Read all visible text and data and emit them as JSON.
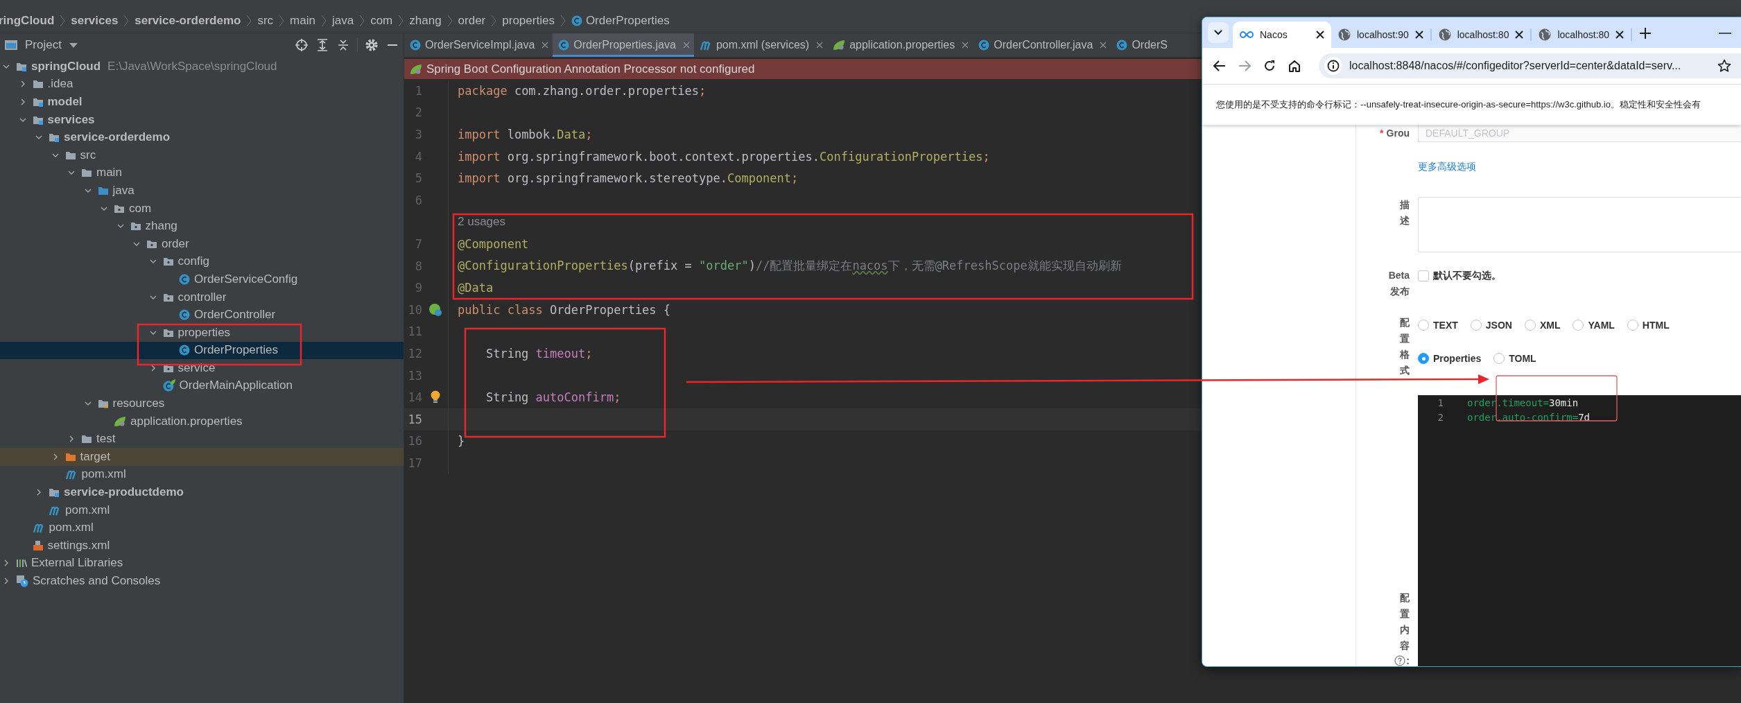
{
  "ide": {
    "breadcrumbs": [
      {
        "label": "ringCloud",
        "kind": "module"
      },
      {
        "label": "services",
        "kind": "module"
      },
      {
        "label": "service-orderdemo",
        "kind": "module"
      },
      {
        "label": "src",
        "kind": "folder"
      },
      {
        "label": "main",
        "kind": "folder"
      },
      {
        "label": "java",
        "kind": "folder"
      },
      {
        "label": "com",
        "kind": "folder"
      },
      {
        "label": "zhang",
        "kind": "folder"
      },
      {
        "label": "order",
        "kind": "folder"
      },
      {
        "label": "properties",
        "kind": "folder"
      },
      {
        "label": "OrderProperties",
        "kind": "class"
      }
    ],
    "project_panel": {
      "title": "Project",
      "tree": [
        {
          "label": "springCloud",
          "kind": "module",
          "path": "E:\\Java\\WorkSpace\\springCloud",
          "expanded": true,
          "selected": false,
          "children": [
            {
              "label": ".idea",
              "kind": "folder",
              "expanded": false,
              "selected": false
            },
            {
              "label": "model",
              "kind": "module",
              "expanded": false,
              "selected": false
            },
            {
              "label": "services",
              "kind": "module",
              "expanded": true,
              "selected": false,
              "children": [
                {
                  "label": "service-orderdemo",
                  "kind": "module",
                  "expanded": true,
                  "selected": false,
                  "children": [
                    {
                      "label": "src",
                      "kind": "folder",
                      "expanded": true,
                      "selected": false,
                      "children": [
                        {
                          "label": "main",
                          "kind": "folder",
                          "expanded": true,
                          "selected": false,
                          "children": [
                            {
                              "label": "java",
                              "kind": "source-folder",
                              "expanded": true,
                              "selected": false,
                              "children": [
                                {
                                  "label": "com",
                                  "kind": "package",
                                  "expanded": true,
                                  "selected": false,
                                  "children": [
                                    {
                                      "label": "zhang",
                                      "kind": "package",
                                      "expanded": true,
                                      "selected": false,
                                      "children": [
                                        {
                                          "label": "order",
                                          "kind": "package",
                                          "expanded": true,
                                          "selected": false,
                                          "children": [
                                            {
                                              "label": "config",
                                              "kind": "package",
                                              "expanded": true,
                                              "selected": false,
                                              "children": [
                                                {
                                                  "label": "OrderServiceConfig",
                                                  "kind": "class",
                                                  "selected": false
                                                }
                                              ]
                                            },
                                            {
                                              "label": "controller",
                                              "kind": "package",
                                              "expanded": true,
                                              "selected": false,
                                              "children": [
                                                {
                                                  "label": "OrderController",
                                                  "kind": "class",
                                                  "selected": false
                                                }
                                              ]
                                            },
                                            {
                                              "label": "properties",
                                              "kind": "package",
                                              "expanded": true,
                                              "selected": false,
                                              "children": [
                                                {
                                                  "label": "OrderProperties",
                                                  "kind": "class",
                                                  "selected": true
                                                }
                                              ]
                                            },
                                            {
                                              "label": "service",
                                              "kind": "package",
                                              "expanded": false,
                                              "selected": false
                                            },
                                            {
                                              "label": "OrderMainApplication",
                                              "kind": "spring-app",
                                              "selected": false
                                            }
                                          ]
                                        }
                                      ]
                                    }
                                  ]
                                }
                              ]
                            },
                            {
                              "label": "resources",
                              "kind": "resources",
                              "expanded": true,
                              "selected": false,
                              "children": [
                                {
                                  "label": "application.properties",
                                  "kind": "spring-properties",
                                  "selected": false
                                }
                              ]
                            }
                          ]
                        },
                        {
                          "label": "test",
                          "kind": "folder",
                          "expanded": false,
                          "selected": false
                        }
                      ]
                    },
                    {
                      "label": "target",
                      "kind": "excluded",
                      "expanded": false,
                      "selected": false
                    },
                    {
                      "label": "pom.xml",
                      "kind": "maven",
                      "selected": false
                    }
                  ]
                },
                {
                  "label": "service-productdemo",
                  "kind": "module",
                  "expanded": false,
                  "selected": false
                },
                {
                  "label": "pom.xml",
                  "kind": "maven",
                  "selected": false
                }
              ]
            },
            {
              "label": "pom.xml",
              "kind": "maven",
              "selected": false
            },
            {
              "label": "settings.xml",
              "kind": "xml",
              "selected": false
            }
          ]
        },
        {
          "label": "External Libraries",
          "kind": "libraries",
          "expanded": false,
          "selected": false
        },
        {
          "label": "Scratches and Consoles",
          "kind": "scratches",
          "expanded": false,
          "selected": false
        }
      ]
    },
    "editor": {
      "tabs": [
        {
          "title": "OrderServiceImpl.java",
          "kind": "class",
          "selected": false,
          "closable": true
        },
        {
          "title": "OrderProperties.java",
          "kind": "class",
          "selected": true,
          "closable": true
        },
        {
          "title": "pom.xml (services)",
          "kind": "maven",
          "selected": false,
          "closable": true
        },
        {
          "title": "application.properties",
          "kind": "spring-properties",
          "selected": false,
          "closable": true
        },
        {
          "title": "OrderController.java",
          "kind": "class",
          "selected": false,
          "closable": true
        },
        {
          "title": "OrderS",
          "kind": "class",
          "selected": false,
          "closable": false
        }
      ],
      "banner": "Spring Boot Configuration Annotation Processor not configured",
      "lines": [
        {
          "kind": "code",
          "number": "1",
          "current": false,
          "tokens": [
            {
              "kind": "kw",
              "text": "package"
            },
            {
              "kind": "plain",
              "text": " com.zhang.order.properties"
            },
            {
              "kind": "kw",
              "text": ";"
            }
          ]
        },
        {
          "kind": "code",
          "number": "2",
          "current": false
        },
        {
          "kind": "code",
          "number": "3",
          "current": false,
          "tokens": [
            {
              "kind": "kw",
              "text": "import"
            },
            {
              "kind": "plain",
              "text": " lombok."
            },
            {
              "kind": "ann",
              "text": "Data"
            },
            {
              "kind": "kw",
              "text": ";"
            }
          ]
        },
        {
          "kind": "code",
          "number": "4",
          "current": false,
          "tokens": [
            {
              "kind": "kw",
              "text": "import"
            },
            {
              "kind": "plain",
              "text": " org.springframework.boot.context.properties."
            },
            {
              "kind": "ann",
              "text": "ConfigurationProperties"
            },
            {
              "kind": "kw",
              "text": ";"
            }
          ]
        },
        {
          "kind": "code",
          "number": "5",
          "current": false,
          "tokens": [
            {
              "kind": "kw",
              "text": "import"
            },
            {
              "kind": "plain",
              "text": " org.springframework.stereotype."
            },
            {
              "kind": "ann",
              "text": "Component"
            },
            {
              "kind": "kw",
              "text": ";"
            }
          ]
        },
        {
          "kind": "code",
          "number": "6",
          "current": false
        },
        {
          "kind": "inlay",
          "text": "2 usages"
        },
        {
          "kind": "code",
          "number": "7",
          "current": false,
          "tokens": [
            {
              "kind": "ann",
              "text": "@Component"
            }
          ]
        },
        {
          "kind": "code",
          "number": "8",
          "current": false,
          "tokens": [
            {
              "kind": "ann",
              "text": "@ConfigurationProperties"
            },
            {
              "kind": "plain",
              "text": "(prefix = "
            },
            {
              "kind": "str",
              "text": "\"order\""
            },
            {
              "kind": "plain",
              "text": ")"
            },
            {
              "kind": "comment",
              "text": "//配置批量绑定在"
            },
            {
              "kind": "typo",
              "text": "nacos"
            },
            {
              "kind": "comment",
              "text": "下，无需@RefreshScope就能实现自动刷新"
            }
          ]
        },
        {
          "kind": "code",
          "number": "9",
          "current": false,
          "tokens": [
            {
              "kind": "ann",
              "text": "@Data"
            }
          ]
        },
        {
          "kind": "bean",
          "number": "10",
          "current": false,
          "tokens": [
            {
              "kind": "kw",
              "text": "public class "
            },
            {
              "kind": "plain",
              "text": "OrderProperties {"
            }
          ]
        },
        {
          "kind": "code",
          "number": "11",
          "current": false
        },
        {
          "kind": "code",
          "number": "12",
          "current": false,
          "tokens": [
            {
              "kind": "plain",
              "text": "    String "
            },
            {
              "kind": "field",
              "text": "timeout"
            },
            {
              "kind": "kw",
              "text": ";"
            }
          ]
        },
        {
          "kind": "code",
          "number": "13",
          "current": false
        },
        {
          "kind": "bulb",
          "number": "14",
          "current": false,
          "tokens": [
            {
              "kind": "plain",
              "text": "    String "
            },
            {
              "kind": "field",
              "text": "autoConfirm"
            },
            {
              "kind": "kw",
              "text": ";"
            }
          ]
        },
        {
          "kind": "code",
          "number": "15",
          "current": true
        },
        {
          "kind": "code",
          "number": "16",
          "current": false,
          "tokens": [
            {
              "kind": "plain",
              "text": "}"
            }
          ]
        },
        {
          "kind": "code",
          "number": "17",
          "current": false
        }
      ]
    }
  },
  "browser": {
    "tabs": [
      {
        "title": "Nacos",
        "kind": "nacos",
        "selected": true
      },
      {
        "title": "localhost:90",
        "kind": "page",
        "selected": false
      },
      {
        "title": "localhost:80",
        "kind": "page",
        "selected": false
      },
      {
        "title": "localhost:80",
        "kind": "page",
        "selected": false
      }
    ],
    "address": "localhost:8848/nacos/#/configeditor?serverId=center&dataId=serv...",
    "warning": "您使用的是不受支持的命令行标记：--unsafely-treat-insecure-origin-as-secure=https://w3c.github.io。稳定性和安全性会有",
    "form": {
      "group": {
        "required_mark": "*",
        "label": "Grou",
        "value": "DEFAULT_GROUP"
      },
      "advanced_link": "更多高级选项",
      "description": {
        "label": "描述"
      },
      "beta": {
        "label": "Beta 发布",
        "checked": false,
        "text": "默认不要勾选。"
      },
      "format": {
        "label": "配置格式",
        "options": [
          {
            "label": "TEXT",
            "selected": false
          },
          {
            "label": "JSON",
            "selected": false
          },
          {
            "label": "XML",
            "selected": false
          },
          {
            "label": "YAML",
            "selected": false
          },
          {
            "label": "HTML",
            "selected": false
          },
          {
            "label": "Properties",
            "selected": true
          },
          {
            "label": "TOML",
            "selected": false
          }
        ]
      },
      "content": {
        "label": "配置内容",
        "suffix": ":",
        "lines": [
          {
            "number": "1",
            "key": "order.timeout=",
            "value": "30min"
          },
          {
            "number": "2",
            "key": "order.auto-confirm=",
            "value": "7d"
          }
        ]
      }
    }
  }
}
